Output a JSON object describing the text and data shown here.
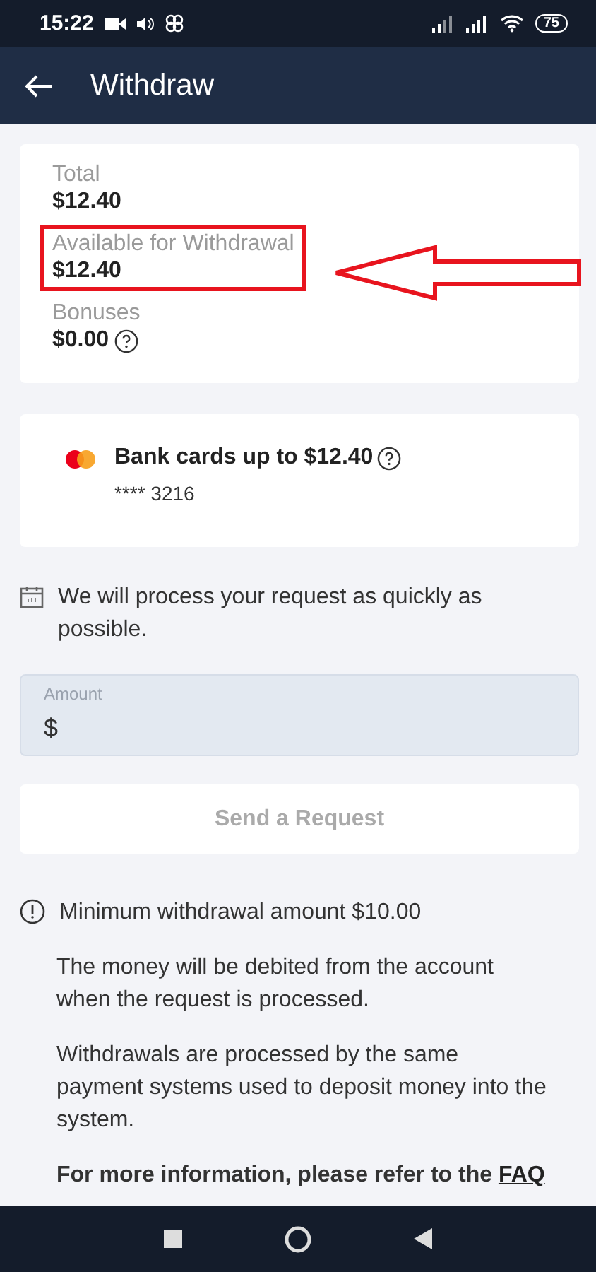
{
  "status_bar": {
    "time": "15:22",
    "battery": "75"
  },
  "app_bar": {
    "title": "Withdraw"
  },
  "balance": [
    {
      "label": "Total",
      "value": "$12.40",
      "highlighted": false,
      "help": false
    },
    {
      "label": "Available for Withdrawal",
      "value": "$12.40",
      "highlighted": true,
      "help": false
    },
    {
      "label": "Bonuses",
      "value": "$0.00",
      "highlighted": false,
      "help": true
    }
  ],
  "method": {
    "title": "Bank cards up to $12.40",
    "card": "**** 3216"
  },
  "notice": "We will process your request as quickly as possible.",
  "amount_field": {
    "label": "Amount",
    "prefix": "$"
  },
  "submit": {
    "label": "Send a Request",
    "disabled": true
  },
  "notes": [
    {
      "kind": "warning",
      "text": "Minimum withdrawal amount $10.00"
    },
    {
      "kind": "plain",
      "text": "The money will be debited from the account when the request is processed."
    },
    {
      "kind": "plain",
      "text": "Withdrawals are processed by the same payment systems used to deposit money into the system."
    },
    {
      "kind": "bold",
      "text": "For more information, please refer to the",
      "link": "FAQ"
    }
  ]
}
